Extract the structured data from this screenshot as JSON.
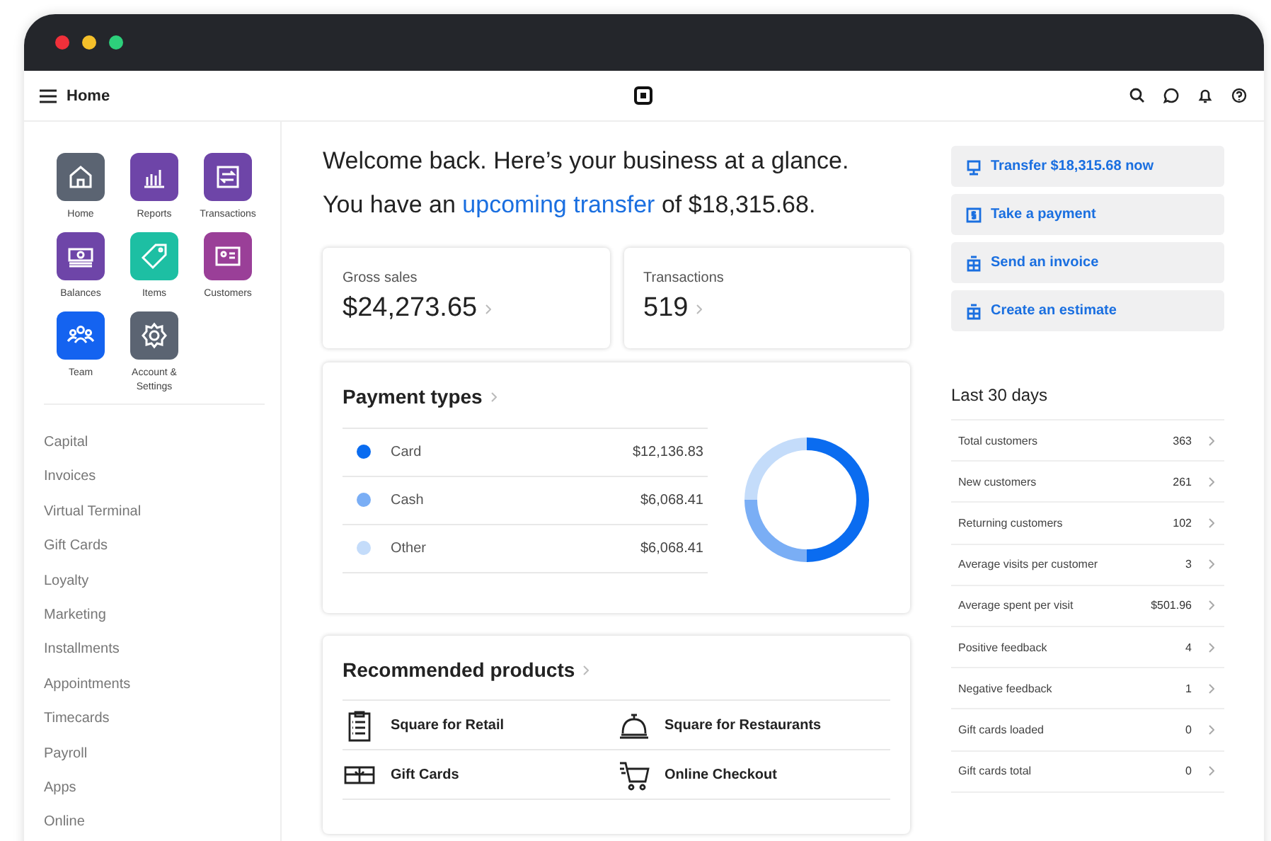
{
  "header": {
    "title": "Home"
  },
  "apps": [
    {
      "label": "Home",
      "color": "#5b6472",
      "kind": "house"
    },
    {
      "label": "Reports",
      "color": "#6e45a8",
      "kind": "chart"
    },
    {
      "label": "Transactions",
      "color": "#6e45a8",
      "kind": "swap"
    },
    {
      "label": "Balances",
      "color": "#6e45a8",
      "kind": "cash"
    },
    {
      "label": "Items",
      "color": "#1dbfa3",
      "kind": "tag"
    },
    {
      "label": "Customers",
      "color": "#9a3f98",
      "kind": "card"
    },
    {
      "label": "Team",
      "color": "#1463f0",
      "kind": "people"
    },
    {
      "label": "Account & Settings",
      "color": "#5b6472",
      "kind": "gear"
    }
  ],
  "nav": [
    "Capital",
    "Invoices",
    "Virtual Terminal",
    "Gift Cards",
    "Loyalty",
    "Marketing",
    "Installments",
    "Appointments",
    "Timecards",
    "Payroll",
    "Apps",
    "Online"
  ],
  "welcome": {
    "line1": "Welcome back. Here’s your business at a glance.",
    "line2_before": "You have an",
    "link": "upcoming transfer",
    "line2_after": "of $18,315.68."
  },
  "stats": [
    {
      "label": "Gross sales",
      "value": "$24,273.65"
    },
    {
      "label": "Transactions",
      "value": "519"
    }
  ],
  "payment_types": {
    "title": "Payment types",
    "rows": [
      {
        "amount": "$12,136.83",
        "color": "#0a6cf0"
      },
      {
        "amount": "$6,068.41",
        "color": "#7aaef5"
      },
      {
        "amount": "$6,068.41",
        "color": "#c4dcfa"
      }
    ],
    "chart_data": {
      "type": "donut",
      "categories": [
        "Card",
        "Cash",
        "Other"
      ],
      "values": [
        50,
        25,
        25
      ]
    }
  },
  "recommended": {
    "title": "Recommended products",
    "items": [
      {
        "label": "Square for Retail",
        "kind": "clipboard"
      },
      {
        "label": "Square for Restaurants",
        "kind": "bell"
      },
      {
        "label": "Gift Cards",
        "kind": "gift"
      },
      {
        "label": "Online Checkout",
        "kind": "cart"
      }
    ]
  },
  "actions": [
    {
      "label": "Transfer $18,315.68 now",
      "kind": "transfer"
    },
    {
      "label": "Take a payment",
      "kind": "dollar"
    },
    {
      "label": "Send an invoice",
      "kind": "doc"
    },
    {
      "label": "Create an estimate",
      "kind": "doc"
    }
  ],
  "last30": {
    "title": "Last 30 days",
    "rows": [
      {
        "label": "Total customers",
        "value": "363"
      },
      {
        "label": "New customers",
        "value": "261"
      },
      {
        "label": "Returning customers",
        "value": "102"
      },
      {
        "label": "Average visits per customer",
        "value": "3"
      },
      {
        "label": "Average spent per visit",
        "value": "$501.96"
      },
      {
        "label": "Positive feedback",
        "value": "4"
      },
      {
        "label": "Negative feedback",
        "value": "1"
      },
      {
        "label": "Gift cards loaded",
        "value": "0"
      },
      {
        "label": "Gift cards total",
        "value": "0"
      }
    ]
  }
}
